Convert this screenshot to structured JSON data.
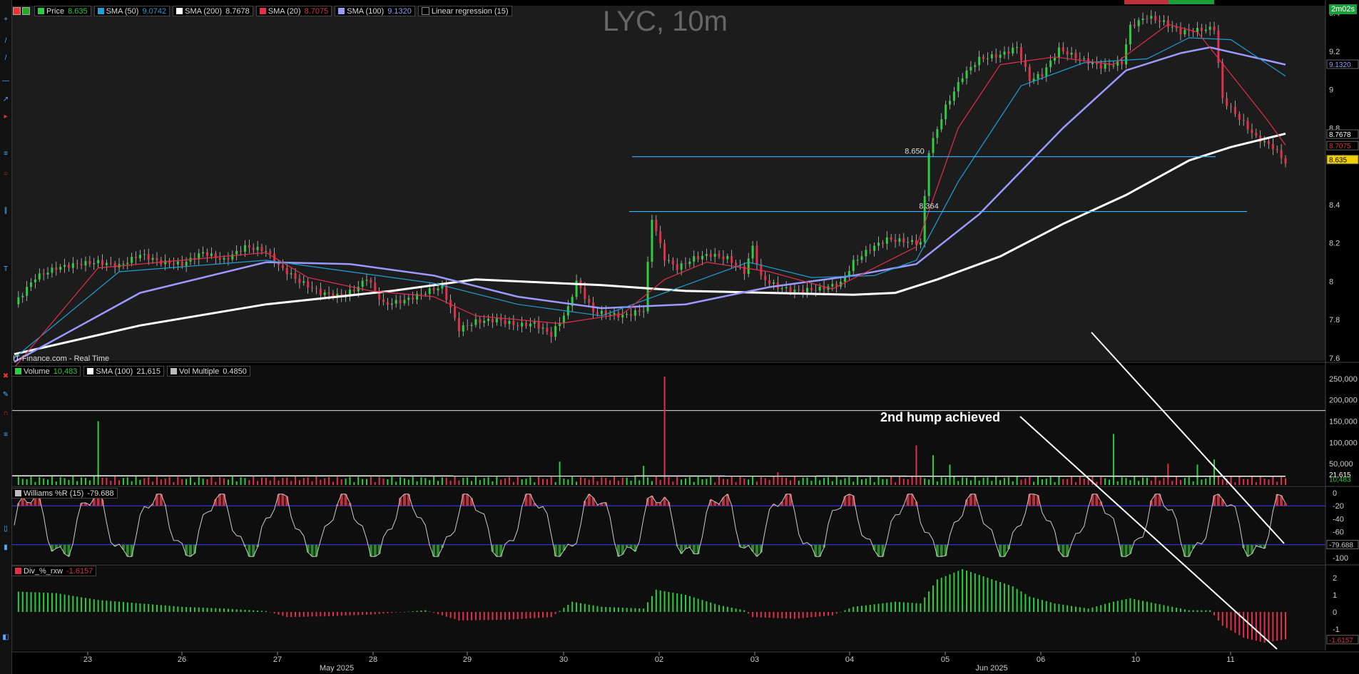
{
  "chart_data": {
    "type": "candlestick",
    "title": "LYC, 10m",
    "timer": "2m02s",
    "source": "IT-Finance.com - Real Time",
    "x_ticks": [
      "23",
      "26",
      "27",
      "28",
      "29",
      "30",
      "02",
      "03",
      "04",
      "05",
      "06",
      "10",
      "11"
    ],
    "month_labels": [
      "May 2025",
      "Jun 2025"
    ],
    "price_axis": {
      "ticks": [
        "9.4",
        "9.2",
        "9",
        "8.8",
        "8.4",
        "8.2",
        "8",
        "7.8",
        "7.6"
      ],
      "ylim": [
        7.6,
        9.4
      ]
    },
    "legend_price": [
      {
        "name": "Price",
        "value": "8.635",
        "color": "#2ecc40"
      },
      {
        "name": "SMA (50)",
        "value": "9.0742",
        "color": "#1e9fd6"
      },
      {
        "name": "SMA (200)",
        "value": "8.7678",
        "color": "#ffffff"
      },
      {
        "name": "SMA (20)",
        "value": "8.7075",
        "color": "#e0304a"
      },
      {
        "name": "SMA (100)",
        "value": "9.1320",
        "color": "#9a9aff"
      },
      {
        "name": "Linear regression (15)",
        "value": "",
        "color": "#000000"
      }
    ],
    "price_tags": [
      {
        "value": "9.1320",
        "price": 9.132,
        "bg": "#000",
        "fg": "#9a9aff"
      },
      {
        "value": "8.7678",
        "price": 8.7678,
        "bg": "#000",
        "fg": "#ffffff"
      },
      {
        "value": "8.7075",
        "price": 8.7075,
        "bg": "#000",
        "fg": "#e0304a"
      },
      {
        "value": "8.635",
        "price": 8.635,
        "bg": "#f2d000",
        "fg": "#000"
      }
    ],
    "hlines": [
      {
        "label": "8.650",
        "value": 8.65
      },
      {
        "label": "8.364",
        "value": 8.364
      }
    ],
    "close_path": [
      [
        0,
        7.88
      ],
      [
        5,
        8.02
      ],
      [
        10,
        8.07
      ],
      [
        15,
        8.09
      ],
      [
        20,
        8.1
      ],
      [
        25,
        8.08
      ],
      [
        30,
        8.14
      ],
      [
        35,
        8.1
      ],
      [
        40,
        8.09
      ],
      [
        45,
        8.15
      ],
      [
        50,
        8.11
      ],
      [
        55,
        8.18
      ],
      [
        60,
        8.16
      ],
      [
        63,
        8.08
      ],
      [
        68,
        8.0
      ],
      [
        73,
        7.94
      ],
      [
        78,
        7.92
      ],
      [
        82,
        7.97
      ],
      [
        84,
        8.02
      ],
      [
        88,
        7.88
      ],
      [
        93,
        7.9
      ],
      [
        100,
        7.96
      ],
      [
        102,
        7.97
      ],
      [
        106,
        7.75
      ],
      [
        110,
        7.79
      ],
      [
        115,
        7.8
      ],
      [
        120,
        7.77
      ],
      [
        124,
        7.78
      ],
      [
        128,
        7.72
      ],
      [
        132,
        7.86
      ],
      [
        134,
        8.0
      ],
      [
        138,
        7.84
      ],
      [
        145,
        7.82
      ],
      [
        150,
        7.85
      ],
      [
        152,
        8.33
      ],
      [
        155,
        8.12
      ],
      [
        158,
        8.07
      ],
      [
        162,
        8.12
      ],
      [
        166,
        8.14
      ],
      [
        170,
        8.12
      ],
      [
        174,
        8.05
      ],
      [
        176,
        8.18
      ],
      [
        178,
        8.02
      ],
      [
        182,
        7.97
      ],
      [
        186,
        7.95
      ],
      [
        192,
        7.96
      ],
      [
        197,
        7.99
      ],
      [
        200,
        8.1
      ],
      [
        204,
        8.17
      ],
      [
        208,
        8.22
      ],
      [
        212,
        8.21
      ],
      [
        216,
        8.2
      ],
      [
        218,
        8.68
      ],
      [
        222,
        8.91
      ],
      [
        226,
        9.07
      ],
      [
        230,
        9.16
      ],
      [
        235,
        9.18
      ],
      [
        239,
        9.22
      ],
      [
        242,
        9.05
      ],
      [
        245,
        9.08
      ],
      [
        249,
        9.21
      ],
      [
        254,
        9.16
      ],
      [
        259,
        9.12
      ],
      [
        264,
        9.14
      ],
      [
        266,
        9.33
      ],
      [
        270,
        9.38
      ],
      [
        274,
        9.35
      ],
      [
        278,
        9.3
      ],
      [
        282,
        9.31
      ],
      [
        286,
        9.32
      ],
      [
        288,
        8.95
      ],
      [
        292,
        8.85
      ],
      [
        296,
        8.75
      ],
      [
        300,
        8.7
      ],
      [
        303,
        8.62
      ]
    ],
    "sma20": [
      [
        0,
        7.55
      ],
      [
        20,
        8.07
      ],
      [
        60,
        8.15
      ],
      [
        70,
        8.02
      ],
      [
        85,
        7.95
      ],
      [
        100,
        7.92
      ],
      [
        110,
        7.82
      ],
      [
        130,
        7.78
      ],
      [
        145,
        7.83
      ],
      [
        155,
        8.01
      ],
      [
        165,
        8.1
      ],
      [
        180,
        8.05
      ],
      [
        195,
        7.96
      ],
      [
        215,
        8.18
      ],
      [
        225,
        8.8
      ],
      [
        235,
        9.13
      ],
      [
        248,
        9.17
      ],
      [
        262,
        9.13
      ],
      [
        275,
        9.34
      ],
      [
        282,
        9.3
      ],
      [
        290,
        9.08
      ],
      [
        298,
        8.86
      ],
      [
        303,
        8.71
      ]
    ],
    "sma50": [
      [
        0,
        7.6
      ],
      [
        25,
        8.05
      ],
      [
        60,
        8.11
      ],
      [
        80,
        8.05
      ],
      [
        100,
        7.99
      ],
      [
        120,
        7.88
      ],
      [
        140,
        7.82
      ],
      [
        160,
        7.98
      ],
      [
        175,
        8.1
      ],
      [
        190,
        8.02
      ],
      [
        205,
        8.03
      ],
      [
        215,
        8.11
      ],
      [
        225,
        8.52
      ],
      [
        240,
        9.02
      ],
      [
        255,
        9.14
      ],
      [
        270,
        9.16
      ],
      [
        280,
        9.27
      ],
      [
        290,
        9.26
      ],
      [
        303,
        9.07
      ]
    ],
    "sma100": [
      [
        0,
        7.58
      ],
      [
        30,
        7.94
      ],
      [
        60,
        8.1
      ],
      [
        80,
        8.09
      ],
      [
        100,
        8.03
      ],
      [
        120,
        7.92
      ],
      [
        140,
        7.86
      ],
      [
        160,
        7.88
      ],
      [
        180,
        7.97
      ],
      [
        200,
        8.03
      ],
      [
        215,
        8.09
      ],
      [
        230,
        8.35
      ],
      [
        250,
        8.8
      ],
      [
        265,
        9.1
      ],
      [
        278,
        9.19
      ],
      [
        285,
        9.22
      ],
      [
        295,
        9.17
      ],
      [
        303,
        9.13
      ]
    ],
    "sma200": [
      [
        0,
        7.62
      ],
      [
        30,
        7.77
      ],
      [
        60,
        7.88
      ],
      [
        90,
        7.95
      ],
      [
        110,
        8.01
      ],
      [
        140,
        7.98
      ],
      [
        160,
        7.95
      ],
      [
        180,
        7.94
      ],
      [
        200,
        7.93
      ],
      [
        210,
        7.94
      ],
      [
        220,
        8.01
      ],
      [
        235,
        8.13
      ],
      [
        250,
        8.3
      ],
      [
        265,
        8.45
      ],
      [
        280,
        8.63
      ],
      [
        290,
        8.7
      ],
      [
        303,
        8.77
      ]
    ],
    "volume": {
      "legend": [
        {
          "name": "Volume",
          "value": "10,483",
          "color": "#2ecc40"
        },
        {
          "name": "SMA (100)",
          "value": "21,615",
          "color": "#ffffff"
        },
        {
          "name": "Vol Multiple",
          "value": "0.4850",
          "color": "#bbbbbb"
        }
      ],
      "ticks": [
        "250,000",
        "200,000",
        "150,000",
        "100,000",
        "50,000"
      ],
      "ylim": [
        0,
        275000
      ],
      "threshold": 175000,
      "sma_value": "21,615",
      "last_value": "10,483",
      "spikes": [
        [
          20,
          150000
        ],
        [
          155,
          255000
        ],
        [
          150,
          45000
        ],
        [
          130,
          55000
        ],
        [
          182,
          30000
        ],
        [
          215,
          93000
        ],
        [
          219,
          70000
        ],
        [
          223,
          48000
        ],
        [
          262,
          120000
        ],
        [
          275,
          50000
        ],
        [
          282,
          48000
        ],
        [
          286,
          60000
        ]
      ]
    },
    "williams": {
      "legend": {
        "name": "Williams %R (15)",
        "value": "-79.688",
        "color": "#bbbbbb"
      },
      "ticks": [
        "0",
        "-20",
        "-40",
        "-60",
        "-80",
        "-100"
      ],
      "ylim": [
        -100,
        0
      ],
      "bands": [
        -20,
        -80
      ],
      "last_value": "-79.688"
    },
    "div": {
      "legend": {
        "name": "Div_%_rxw",
        "value": "-1.6157",
        "color": "#e0304a"
      },
      "ticks": [
        "2",
        "1",
        "0",
        "-1"
      ],
      "ylim": [
        -2,
        2.5
      ],
      "last_value": "-1.6157",
      "path": [
        [
          0,
          1.2
        ],
        [
          10,
          1.1
        ],
        [
          20,
          0.7
        ],
        [
          30,
          0.5
        ],
        [
          40,
          0.3
        ],
        [
          50,
          0.2
        ],
        [
          60,
          0.05
        ],
        [
          65,
          -0.3
        ],
        [
          75,
          -0.25
        ],
        [
          85,
          -0.15
        ],
        [
          98,
          0.1
        ],
        [
          106,
          -0.5
        ],
        [
          118,
          -0.45
        ],
        [
          128,
          -0.3
        ],
        [
          133,
          0.6
        ],
        [
          140,
          0.3
        ],
        [
          150,
          0.2
        ],
        [
          153,
          1.3
        ],
        [
          160,
          1.0
        ],
        [
          168,
          0.4
        ],
        [
          174,
          0.1
        ],
        [
          176,
          -0.3
        ],
        [
          186,
          -0.4
        ],
        [
          195,
          -0.2
        ],
        [
          200,
          0.3
        ],
        [
          210,
          0.6
        ],
        [
          216,
          0.5
        ],
        [
          220,
          1.9
        ],
        [
          226,
          2.5
        ],
        [
          232,
          2.0
        ],
        [
          238,
          1.5
        ],
        [
          242,
          0.9
        ],
        [
          248,
          0.5
        ],
        [
          256,
          0.2
        ],
        [
          262,
          0.6
        ],
        [
          266,
          0.8
        ],
        [
          272,
          0.5
        ],
        [
          280,
          0.1
        ],
        [
          285,
          0.1
        ],
        [
          288,
          -0.8
        ],
        [
          293,
          -1.5
        ],
        [
          298,
          -1.8
        ],
        [
          303,
          -1.6
        ]
      ]
    },
    "annotation": "2nd hump achieved"
  }
}
